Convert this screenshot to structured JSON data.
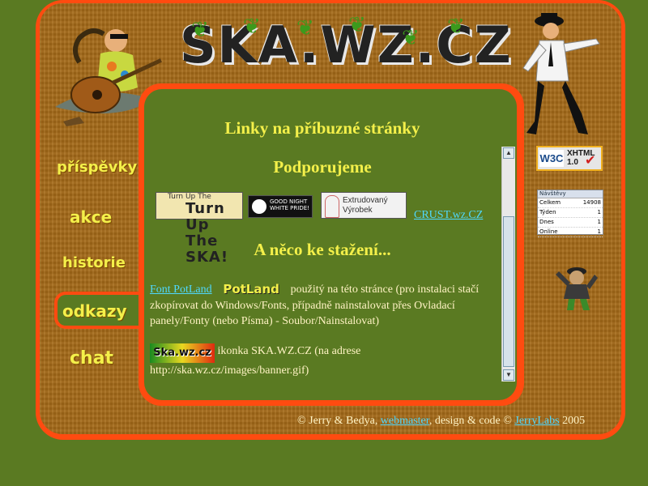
{
  "header": {
    "logo_text": "SKA.WZ.CZ"
  },
  "nav": {
    "items": [
      {
        "label": "příspěvky"
      },
      {
        "label": "akce"
      },
      {
        "label": "historie"
      },
      {
        "label": "odkazy"
      },
      {
        "label": "chat"
      }
    ],
    "active": "odkazy"
  },
  "content": {
    "title": "Linky na příbuzné stránky",
    "support_heading": "Podporujeme",
    "banners": [
      {
        "text": "Turn Up The SKA!"
      },
      {
        "text": "GOOD NIGHT WHITE PRIDE!"
      },
      {
        "text": "Extrudovaný Výrobek"
      }
    ],
    "crust_link": "CRUST.wz.CZ",
    "download_heading": "A něco ke stažení...",
    "font_link": "Font PotLand",
    "font_sample": "PotLand",
    "font_desc": "použitý na této stránce (pro instalaci stačí zkopírovat do Windows/Fonts, případně nainstalovat přes Ovladací panely/Fonty (nebo Písma) - Soubor/Nainstalovat)",
    "icon_sample": "Ska.wz.cz",
    "icon_desc": "ikonka SKA.WZ.CZ (na adrese http://ska.wz.cz/images/banner.gif)"
  },
  "badges": {
    "w3c_left": "W3C",
    "w3c_right_1": "XHTML",
    "w3c_right_2": "1.0",
    "counter_title": "Návštěvy",
    "counter_rows": [
      {
        "label": "Celkem",
        "value": "14908"
      },
      {
        "label": "Týden",
        "value": "1"
      },
      {
        "label": "Dnes",
        "value": "1"
      },
      {
        "label": "Online",
        "value": "1"
      }
    ]
  },
  "footer": {
    "prefix": "© Jerry & Bedya,",
    "webmaster_link": "webmaster",
    "middle": ", design & code ©",
    "jerrylabs_link": "JerryLabs",
    "year": "2005"
  },
  "colors": {
    "page_bg": "#5a7a22",
    "frame": "#ff4b10",
    "wood": "#a56a18",
    "heading": "#f4f04a",
    "link": "#4fd8ff",
    "text": "#fff3c4"
  }
}
